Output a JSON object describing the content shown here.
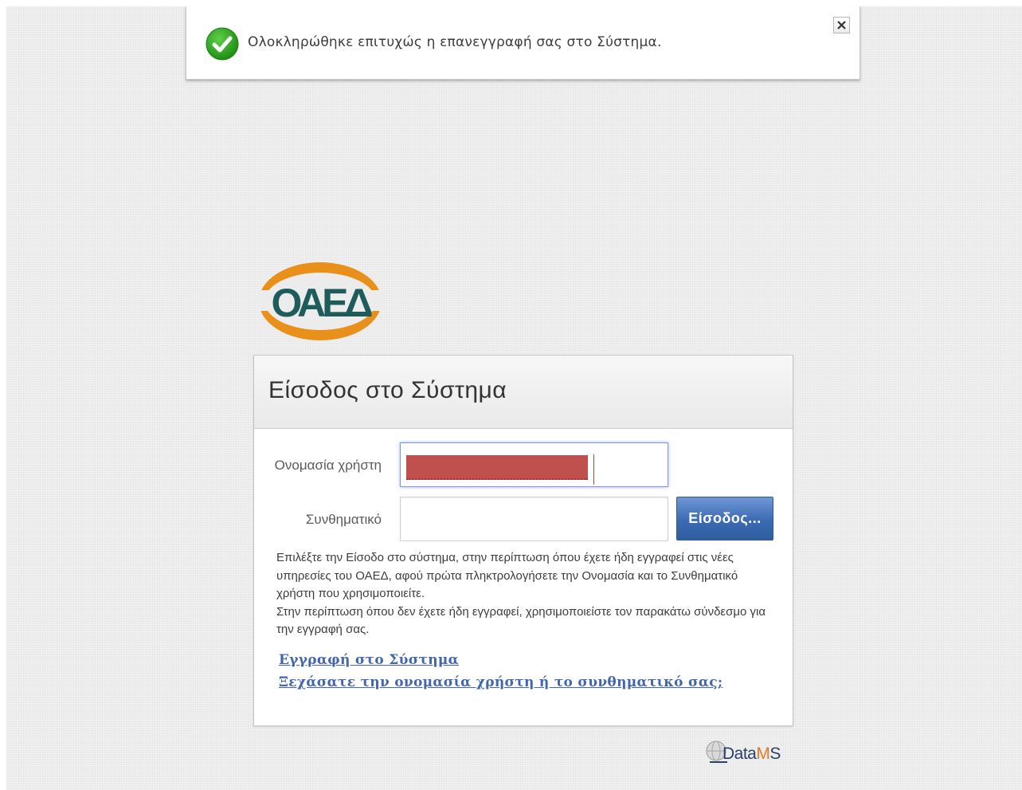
{
  "notification": {
    "message": "Ολοκληρώθηκε επιτυχώς η επανεγγραφή σας στο Σύστημα.",
    "icon": "check-circle-icon",
    "close_icon": "close-icon",
    "accent_color": "#2ea81b"
  },
  "logo": {
    "text": "ΟΑΕΔ",
    "ring_color": "#e8901a",
    "text_color": "#1d5c5a"
  },
  "login": {
    "title": "Είσοδος στο Σύστημα",
    "username_label": "Ονομασία χρήστη",
    "username_value": "",
    "password_label": "Συνθηματικό",
    "password_value": "",
    "submit_label": "Είσοδος...",
    "help_paragraph_1": "Επιλέξτε την Είσοδο στο σύστημα, στην περίπτωση όπου έχετε ήδη εγγραφεί στις νέες υπηρεσίες του ΟΑΕΔ, αφού πρώτα πληκτρολογήσετε την Ονομασία και το Συνθηματικό χρήστη που χρησιμοποιείτε.",
    "help_paragraph_2": "Στην περίπτωση όπου δεν έχετε ήδη εγγραφεί, χρησιμοποιείστε τον παρακάτω σύνδεσμο για την εγγραφή σας.",
    "register_link": "Εγγραφή στο Σύστημα",
    "forgot_link": "Ξεχάσατε την ονομασία χρήστη ή το συνθηματικό σας;",
    "button_color": "#3b6bb3",
    "link_color": "#4466aa"
  },
  "footer": {
    "brand_data": "Data",
    "brand_m": "M",
    "brand_s": "S"
  }
}
